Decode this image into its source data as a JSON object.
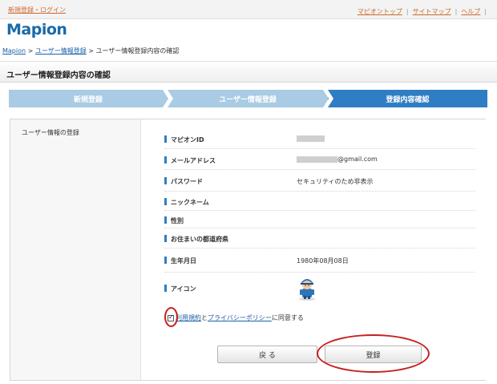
{
  "topbar": {
    "login_link": "新規登録・ログイン",
    "links": [
      "マピオントップ",
      "サイトマップ",
      "ヘルプ"
    ]
  },
  "logo": {
    "text": "Mapion"
  },
  "breadcrumb": {
    "home": "Mapion",
    "sep": " > ",
    "register": "ユーザー情報登録",
    "current": "ユーザー情報登録内容の確認"
  },
  "page": {
    "title": "ユーザー情報登録内容の確認"
  },
  "steps": [
    "新規登録",
    "ユーザー情報登録",
    "登録内容確認"
  ],
  "panel": {
    "side_label": "ユーザー情報の登録",
    "fields": [
      {
        "label": "マピオンID",
        "value": ""
      },
      {
        "label": "メールアドレス",
        "value": "@gmail.com"
      },
      {
        "label": "パスワード",
        "value": "セキュリティのため非表示"
      },
      {
        "label": "ニックネーム",
        "value": ""
      },
      {
        "label": "性別",
        "value": ""
      },
      {
        "label": "お住まいの都道府県",
        "value": ""
      },
      {
        "label": "生年月日",
        "value": "1980年08月08日"
      },
      {
        "label": "アイコン",
        "value": ""
      }
    ],
    "agree": {
      "terms": "利用規約",
      "and": "と",
      "privacy": "プライバシーポリシー",
      "suffix": "に同意する"
    },
    "buttons": {
      "back": "戻 る",
      "submit": "登録"
    }
  },
  "colors": {
    "accent": "#2f7ec4",
    "step_inactive": "#a9cbe3",
    "highlight": "#c81e1e",
    "link": "#1a5fa8",
    "top_link": "#cc6a2c"
  }
}
